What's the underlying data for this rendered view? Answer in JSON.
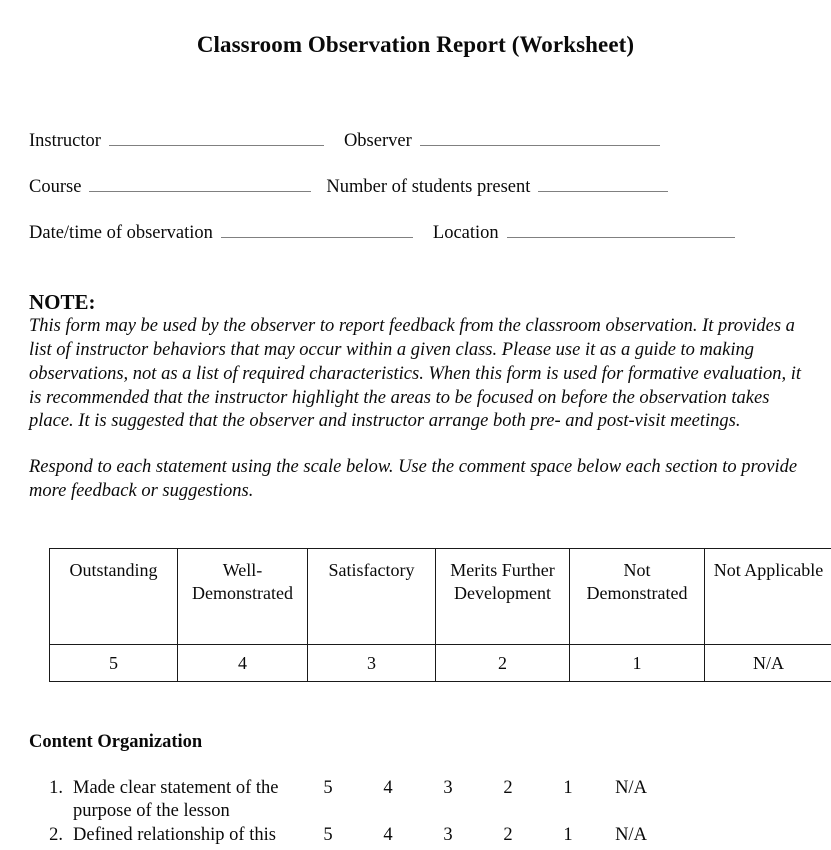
{
  "document": {
    "title": "Classroom Observation Report (Worksheet)"
  },
  "form_fields": {
    "row1": {
      "left_label": "Instructor",
      "left_value": "",
      "right_label": "Observer",
      "right_value": ""
    },
    "row2": {
      "left_label": "Course",
      "left_value": "",
      "right_label": "Number of students present",
      "right_value": ""
    },
    "row3": {
      "left_label": "Date/time of observation",
      "left_value": "",
      "right_label": "Location",
      "right_value": ""
    }
  },
  "note": {
    "heading": "NOTE:",
    "paragraph1": "This form may be used by the observer to report feedback from the classroom observation. It provides a list of instructor behaviors that may occur within a given class. Please use it as a guide to making observations, not as a list of required characteristics. When this form is used for formative evaluation, it is recommended that the instructor highlight the areas to be focused on before the observation takes place. It is suggested that the observer and instructor arrange both pre- and post-visit meetings.",
    "paragraph2": "Respond to each statement using the scale below. Use the comment space below each section to provide more feedback or suggestions."
  },
  "scale_table": {
    "headers": [
      "Outstanding",
      "Well-Demonstrated",
      "Satisfactory",
      "Merits Further Development",
      "Not Demonstrated",
      "Not Applicable"
    ],
    "values": [
      "5",
      "4",
      "3",
      "2",
      "1",
      "N/A"
    ]
  },
  "section": {
    "heading": "Content Organization",
    "items": [
      {
        "number": "1.",
        "text": "Made clear statement of the purpose of the lesson",
        "scale": [
          "5",
          "4",
          "3",
          "2",
          "1",
          "N/A"
        ]
      },
      {
        "number": "2.",
        "text": "Defined relationship of this",
        "scale": [
          "5",
          "4",
          "3",
          "2",
          "1",
          "N/A"
        ]
      }
    ]
  }
}
